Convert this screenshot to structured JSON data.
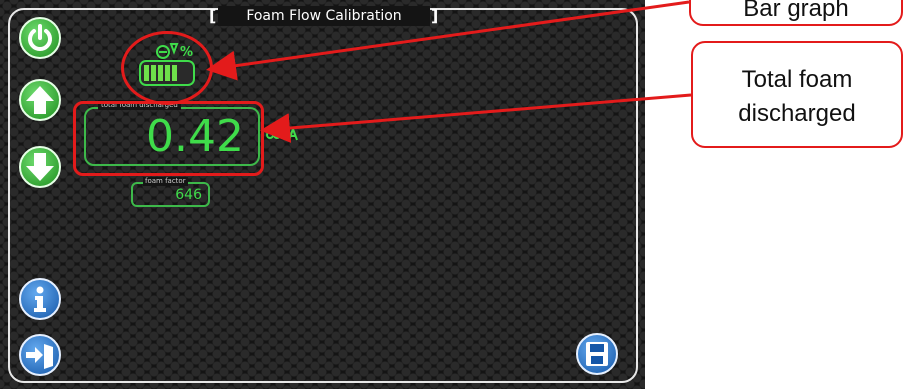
{
  "screen": {
    "title": "Foam Flow Calibration",
    "total_foam": {
      "label": "total foam discharged",
      "value": "0.42"
    },
    "foam_factor": {
      "label": "foam factor",
      "value": "646"
    },
    "bar_graph_percent_symbol": "%"
  },
  "side_buttons": [
    {
      "icon": "power-icon"
    },
    {
      "icon": "arrow-up-icon"
    },
    {
      "icon": "arrow-down-icon"
    },
    {
      "icon": "info-icon"
    },
    {
      "icon": "exit-icon"
    }
  ],
  "save_button": {
    "icon": "save-icon"
  },
  "annotations": {
    "bar_graph": "Bar graph",
    "total_foam_line1": "Total foam",
    "total_foam_line2": "discharged"
  },
  "colors": {
    "accent_green": "#3fdc4a",
    "annotation_red": "#e31b1b",
    "button_blue": "#1e74d0",
    "button_green": "#2fae2f"
  }
}
